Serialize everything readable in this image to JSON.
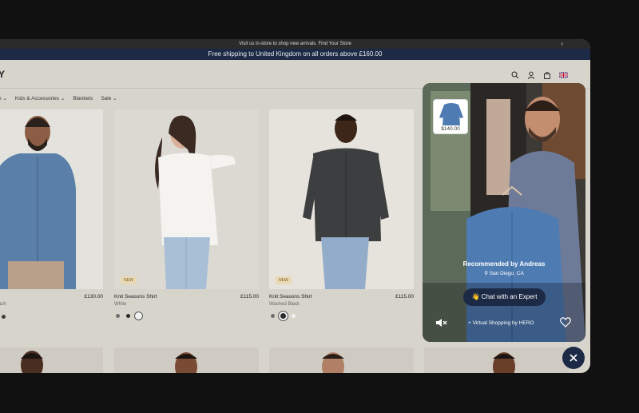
{
  "topbar": {
    "text": "Visit us in-store to shop new arrivals. Find Your Store",
    "chevron_icon": "chevron-right-icon"
  },
  "shipbar": {
    "text": "Free shipping to United Kingdom on all orders above £160.00"
  },
  "header": {
    "logo": "Y",
    "icons": [
      "search-icon",
      "account-icon",
      "bag-icon",
      "uk-flag-icon"
    ]
  },
  "nav": {
    "items": [
      "n ⌄",
      "Kids & Accessories ⌄",
      "Blankets",
      "Sale ⌄"
    ]
  },
  "products": [
    {
      "name": "t",
      "price": "£130.00",
      "color": "ash",
      "badge": "",
      "swatches": [
        "#3b3b3b"
      ]
    },
    {
      "name": "Knit Seasons Shirt",
      "price": "£115.00",
      "color": "White",
      "badge": "NEW",
      "swatches": [
        "#6f6f6f",
        "#2a2a2a",
        "#f2f2f2"
      ]
    },
    {
      "name": "Knit Seasons Shirt",
      "price": "£115.00",
      "color": "Washed Black",
      "badge": "NEW",
      "swatches": [
        "#6f6f6f",
        "#2a2a2a",
        "#f2f2f2"
      ]
    }
  ],
  "video": {
    "thumb_price": "$140.00",
    "recommended": "Recommended by Andreas",
    "location": "San Diego, CA",
    "chat_label": "👋 Chat with an Expert",
    "footer": "Virtual Shopping by HERO",
    "icons": [
      "mute-icon",
      "heart-icon",
      "pin-icon"
    ]
  },
  "close_icon": "close-icon",
  "colors": {
    "navy": "#1c2a45",
    "page_bg": "#d7d4cc",
    "outer_bg": "#111111"
  }
}
